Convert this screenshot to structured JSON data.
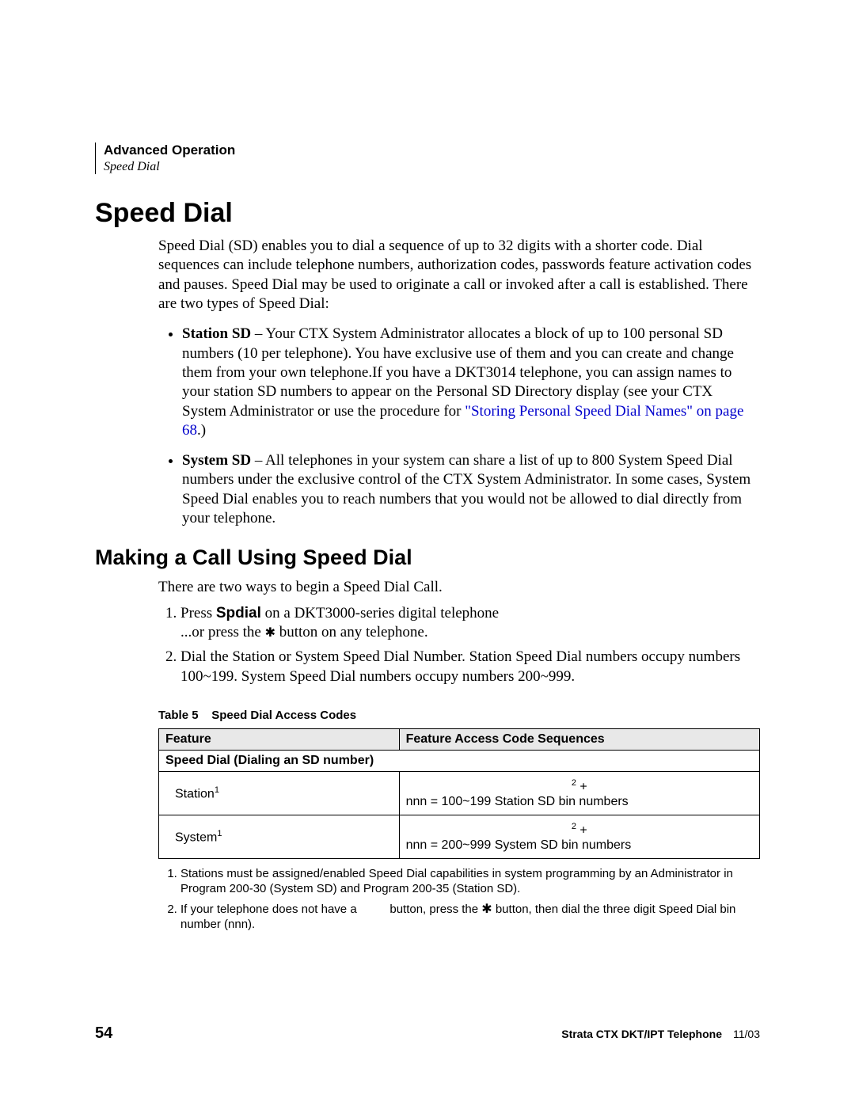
{
  "header": {
    "chapter": "Advanced Operation",
    "section": "Speed Dial"
  },
  "h1": "Speed Dial",
  "intro": "Speed Dial (SD) enables you to dial a sequence of up to 32 digits with a shorter code. Dial sequences can include telephone numbers, authorization codes, passwords feature activation codes and pauses. Speed Dial may be used to originate a call or invoked after a call is established. There are two types of Speed Dial:",
  "bullets": {
    "station": {
      "bold": "Station SD",
      "text1": " – Your CTX System Administrator allocates a block of up to 100 personal SD numbers (10 per telephone). You have exclusive use of them and you can create and change them from your own telephone.If you have a DKT3014 telephone, you can assign names to your station SD numbers to appear on the Personal SD Directory display (see your CTX System Administrator or use the procedure for ",
      "link": "\"Storing Personal Speed Dial Names\" on page 68",
      "text2": ".)"
    },
    "system": {
      "bold": "System SD",
      "text": " – All telephones in your system can share a list of up to 800 System Speed Dial numbers under the exclusive control of the CTX System Administrator. In some cases, System Speed Dial enables you to reach numbers that you would not be allowed to dial directly from your telephone."
    }
  },
  "h2": "Making a Call Using Speed Dial",
  "body2": "There are two ways to begin a Speed Dial Call.",
  "steps": {
    "s1a": "Press ",
    "s1_bold": "Spdial",
    "s1b": " on a DKT3000-series digital telephone",
    "s1c": "...or press the ",
    "s1d": " button on any telephone.",
    "s2": "Dial the Station or System Speed Dial Number. Station Speed Dial numbers occupy numbers 100~199. System Speed Dial numbers occupy numbers 200~999."
  },
  "table": {
    "caption_label": "Table 5",
    "caption_text": "Speed Dial Access Codes",
    "headers": {
      "feature": "Feature",
      "facs": "Feature Access Code Sequences"
    },
    "group_header": "Speed Dial (Dialing an SD number)",
    "rows": [
      {
        "feature": "Station",
        "fn": "1",
        "code_sup": "2",
        "code_plus": "+",
        "code_line": "nnn = 100~199 Station SD bin numbers"
      },
      {
        "feature": "System",
        "fn": "1",
        "code_sup": "2",
        "code_plus": "+",
        "code_line": "nnn = 200~999 System SD bin numbers"
      }
    ]
  },
  "footnotes": {
    "f1": "Stations must be assigned/enabled Speed Dial capabilities in system programming by an Administrator in Program 200-30 (System SD) and Program 200-35 (Station SD).",
    "f2a": "If your telephone does not have a ",
    "f2b": " button, press the ",
    "f2c": " button, then dial the three digit Speed Dial bin number (nnn)."
  },
  "footer": {
    "page": "54",
    "product": "Strata CTX DKT/IPT Telephone",
    "date": "11/03"
  },
  "star": "✱",
  "chart_data": {
    "type": "table",
    "title": "Speed Dial Access Codes",
    "columns": [
      "Feature",
      "Feature Access Code Sequences"
    ],
    "rows": [
      [
        "Station",
        "nnn = 100~199 Station SD bin numbers"
      ],
      [
        "System",
        "nnn = 200~999 System SD bin numbers"
      ]
    ]
  }
}
